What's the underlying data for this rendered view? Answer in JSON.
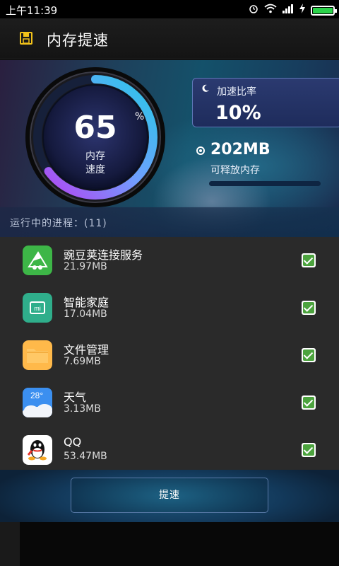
{
  "status_bar": {
    "time": "上午11:39",
    "icons": [
      "alarm-icon",
      "wifi-icon",
      "signal-icon",
      "charging-icon",
      "battery-icon"
    ],
    "battery_level": 1.0
  },
  "header": {
    "title": "内存提速",
    "icon": "save-icon"
  },
  "gauge": {
    "value": "65",
    "unit": "%",
    "label_line1": "内存",
    "label_line2": "速度",
    "level": 0.65
  },
  "ratio": {
    "label": "加速比率",
    "value": "10%"
  },
  "releasable": {
    "value": "202MB",
    "label": "可释放内存",
    "level": 0.0
  },
  "process_header": "运行中的进程：(11)",
  "apps": [
    {
      "name": "豌豆荚连接服务",
      "size": "21.97MB",
      "icon": "wandoujia-icon",
      "checked": true
    },
    {
      "name": "智能家庭",
      "size": "17.04MB",
      "icon": "mi-home-icon",
      "checked": true
    },
    {
      "name": "文件管理",
      "size": "7.69MB",
      "icon": "folder-icon",
      "checked": true
    },
    {
      "name": "天气",
      "size": "3.13MB",
      "icon": "weather-icon",
      "weather_temp": "28°",
      "checked": true
    },
    {
      "name": "QQ",
      "size": "53.47MB",
      "icon": "qq-icon",
      "checked": true
    }
  ],
  "boost_button": "提速",
  "colors": {
    "accent_green": "#4ca33e",
    "ratio_box": "#2b3a70",
    "hero_teal": "#14516a"
  }
}
